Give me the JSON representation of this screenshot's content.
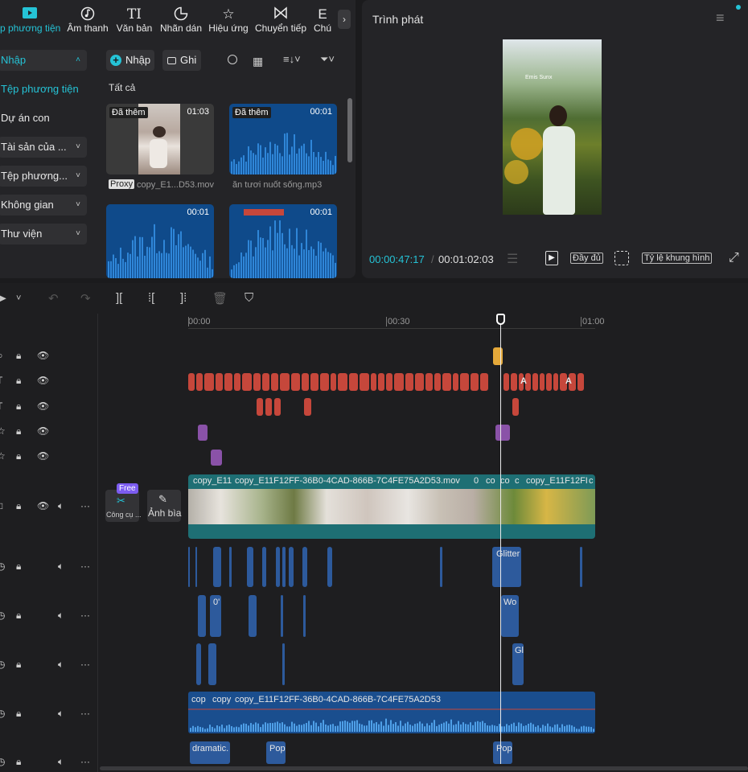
{
  "media_panel": {
    "tabs": [
      {
        "label": "p phương tiện",
        "icon": "media-play-icon"
      },
      {
        "label": "Âm thanh",
        "icon": "music-note-icon"
      },
      {
        "label": "Văn bản",
        "icon": "text-icon"
      },
      {
        "label": "Nhãn dán",
        "icon": "sticker-icon"
      },
      {
        "label": "Hiệu ứng",
        "icon": "sparkle-star-icon"
      },
      {
        "label": "Chuyển tiếp",
        "icon": "bowtie-transition-icon"
      },
      {
        "label": "Chú",
        "icon": "caption-icon"
      }
    ],
    "sidebar": [
      {
        "label": "Nhập",
        "chevron": "˄"
      },
      {
        "label": "Tệp phương tiện"
      },
      {
        "label": "Dự án con"
      },
      {
        "label": "Tài sản của ...",
        "chevron": "˅"
      },
      {
        "label": "Tệp phương...",
        "chevron": "˅"
      },
      {
        "label": "Không gian",
        "chevron": "˅"
      },
      {
        "label": "Thư viện",
        "chevron": "˅"
      }
    ],
    "import_button": "Nhập",
    "record_button": "Ghi",
    "filter_label": "Tất cả",
    "cards": [
      {
        "badge": "Đã thêm",
        "duration": "01:03",
        "proxy": "Proxy",
        "name": "copy_E1...D53.mov"
      },
      {
        "badge": "Đã thêm",
        "duration": "00:01",
        "name": "ăn tươi nuốt sống.mp3"
      },
      {
        "duration": "00:01"
      },
      {
        "duration": "00:01"
      }
    ]
  },
  "player": {
    "title": "Trình phát",
    "current_time": "00:00:47:17",
    "total_time": "00:01:02:03",
    "full_button": "Đầy đủ",
    "ratio_button": "Tỷ lệ khung hình",
    "overlay_text": "Emis Sunx"
  },
  "timeline": {
    "ruler": [
      "00:00",
      "00:30",
      "01:00"
    ],
    "tool_free_badge": "Free",
    "tool_label": "Công cụ ...",
    "cover_label": "Ảnh bìa",
    "video_clips": [
      "copy_E11",
      "copy_E11F12FF-36B0-4CAD-866B-7C4FE75A2D53.mov",
      "0",
      "co",
      "co",
      "c",
      "copy_E11F12FI",
      "c"
    ],
    "audio_clip_labels": [
      "Glitter",
      "0'",
      "Wo",
      "Gl"
    ],
    "audio_main_labels": [
      "cop",
      "copy",
      "copy_E11F12FF-36B0-4CAD-866B-7C4FE75A2D53"
    ],
    "sfx_labels": [
      "dramatic.",
      "Pop",
      "Pop"
    ],
    "text_badge": "A"
  },
  "colors": {
    "accent": "#25c3d6",
    "text_clip": "#c6473b",
    "audio_clip": "#2d5a9c",
    "video_clip": "#1e6f74",
    "sticker": "#8a52a8",
    "marker": "#e5a93a"
  }
}
